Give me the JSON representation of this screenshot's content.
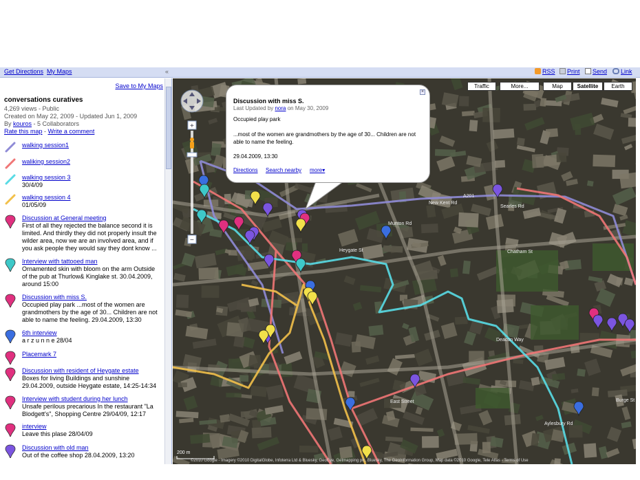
{
  "topbar": {
    "get_directions": "Get Directions",
    "my_maps": "My Maps",
    "collapse": "«",
    "rss": "RSS",
    "print": "Print",
    "send": "Send",
    "link": "Link"
  },
  "panel": {
    "save_label": "Save to My Maps",
    "title": "conversations curatives",
    "views": "4,269 views - Public",
    "created": "Created on May 22, 2009 - Updated Jun 1, 2009",
    "by_prefix": "By ",
    "author": "kouros",
    "collaborators": " - 5 Collaborators",
    "rate": "Rate this map",
    "sep": " - ",
    "comment": "Write a comment",
    "items": [
      {
        "icon": "line-icon",
        "color": "#8f8bd6",
        "title": "walking session1",
        "desc": ""
      },
      {
        "icon": "line-icon",
        "color": "#f07676",
        "title": "waliking session2",
        "desc": ""
      },
      {
        "icon": "line-icon",
        "color": "#59dbe5",
        "title": "walking session 3",
        "desc": "30/4/09"
      },
      {
        "icon": "line-icon",
        "color": "#f2c04a",
        "title": "walking session 4",
        "desc": "01/05/09"
      },
      {
        "icon": "pin-icon",
        "color": "#e0307f",
        "title": "Discussion at General meeting",
        "desc": "First of all they rejected the balance second it is limited. And thirdly they did not properly insult the wilder area, now we are an involved area, and if you ask people they would say they dont know ..."
      },
      {
        "icon": "pin-icon",
        "color": "#3ec8c8",
        "title": "Interview with tattooed man",
        "desc": "Ornamented skin with bloom on the arm Outside of the pub at Thurlow& Kinglake st. 30.04.2009, around 15:00"
      },
      {
        "icon": "pin-icon",
        "color": "#e0307f",
        "title": "Discussion with miss S.",
        "desc": "Occupied play park ...most of the women are grandmothers by the age of 30... Children are not able to name the feeling. 29.04.2009, 13:30"
      },
      {
        "icon": "pin-icon",
        "color": "#3a6ee0",
        "title": "6th interview",
        "desc": "a r z u n n e 28/04"
      },
      {
        "icon": "pin-icon",
        "color": "#e0307f",
        "title": "Placemark 7",
        "desc": ""
      },
      {
        "icon": "pin-icon",
        "color": "#e0307f",
        "title": "Discussion with resident of Heygate estate",
        "desc": "Boxes for living Buildings and sunshine 29.04.2009, outside Heygate estate, 14:25-14:34"
      },
      {
        "icon": "pin-icon",
        "color": "#e0307f",
        "title": "Interview with student during her lunch",
        "desc": "Unsafe perilous precarious In the restaurant \"La Blodgett's\", Shopping Centre 29/04/09, 12:17"
      },
      {
        "icon": "pin-icon",
        "color": "#e0307f",
        "title": "interview",
        "desc": "Leave this plase 28/04/09"
      },
      {
        "icon": "pin-icon",
        "color": "#7b55e0",
        "title": "Discussion with old man",
        "desc": "Out of the coffee shop 28.04.2009, 13:20"
      }
    ]
  },
  "map": {
    "buttons": [
      "Traffic",
      "More...",
      "Map",
      "Satellite",
      "Earth"
    ],
    "active_type": "Satellite",
    "street_labels": [
      "New Kent Rd",
      "A201",
      "Searles Rd",
      "Munton Rd",
      "Heygate St",
      "Chatham St",
      "Deacon Way",
      "East Street",
      "Aylesbury Rd",
      "Burge St"
    ],
    "copyright": "©2010 Google - Imagery ©2010 DigitalGlobe, Infoterra Ltd & Bluesky, GeoEye, Getmapping plc, Bluesky, The GeoInformation Group, Map data ©2010 Google, Tele Atlas - Terms of Use",
    "scale": "200 m",
    "popup": {
      "title": "Discussion with miss S.",
      "updated_prefix": "Last Updated by ",
      "updated_user": "nora",
      "updated_suffix": " on May 30, 2009",
      "subtitle": "Occupied play park",
      "body": "...most of the women are grandmothers by the age of 30... Children are not able to name the feeling.",
      "date": "29.04.2009, 13:30",
      "links": [
        "Directions",
        "Search nearby",
        "more▾"
      ],
      "close": "×"
    }
  }
}
